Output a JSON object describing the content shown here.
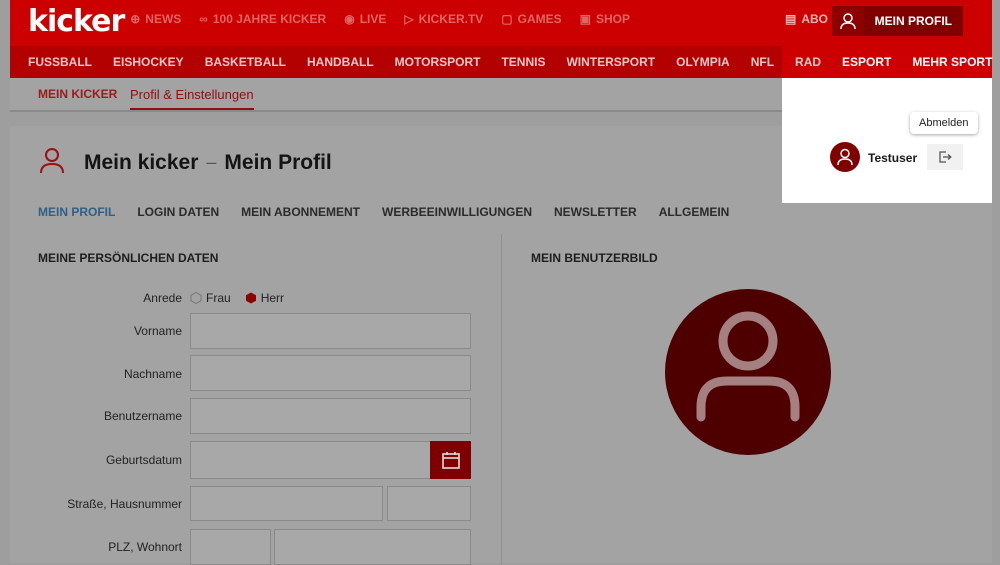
{
  "header": {
    "logo": "kicker",
    "top_nav": [
      {
        "label": "NEWS",
        "icon": "globe-icon"
      },
      {
        "label": "100 JAHRE KICKER",
        "icon": "infinity-icon"
      },
      {
        "label": "LIVE",
        "icon": "live-icon"
      },
      {
        "label": "KICKER.TV",
        "icon": "play-icon"
      },
      {
        "label": "GAMES",
        "icon": "gamepad-icon"
      },
      {
        "label": "SHOP",
        "icon": "bag-icon"
      },
      {
        "label": "ABO",
        "icon": "newspaper-icon"
      }
    ],
    "profile_label": "MEIN PROFIL",
    "categories": [
      "FUSSBALL",
      "EISHOCKEY",
      "BASKETBALL",
      "HANDBALL",
      "MOTORSPORT",
      "TENNIS",
      "WINTERSPORT",
      "OLYMPIA",
      "NFL",
      "RAD",
      "ESPORT",
      "MEHR SPORT"
    ]
  },
  "subnav": {
    "item1": "MEIN KICKER",
    "item2": "Profil & Einstellungen"
  },
  "page": {
    "title1": "Mein kicker",
    "sep": "–",
    "title2": "Mein Profil",
    "tabs": [
      "MEIN PROFIL",
      "LOGIN DATEN",
      "MEIN ABONNEMENT",
      "WERBEEINWILLIGUNGEN",
      "NEWSLETTER",
      "ALLGEMEIN"
    ]
  },
  "form": {
    "section_title": "MEINE PERSÖNLICHEN DATEN",
    "anrede_label": "Anrede",
    "option_frau": "Frau",
    "option_herr": "Herr",
    "vorname_label": "Vorname",
    "nachname_label": "Nachname",
    "benutzername_label": "Benutzername",
    "geburtsdatum_label": "Geburtsdatum",
    "strasse_label": "Straße, Hausnummer",
    "plz_label": "PLZ, Wohnort"
  },
  "avatar_section": {
    "title": "MEIN BENUTZERBILD"
  },
  "user": {
    "name": "Testuser",
    "logout_tooltip": "Abmelden"
  },
  "colors": {
    "brand": "#cc0000",
    "dark_red": "#800000",
    "active_tab": "#2e5f86"
  }
}
